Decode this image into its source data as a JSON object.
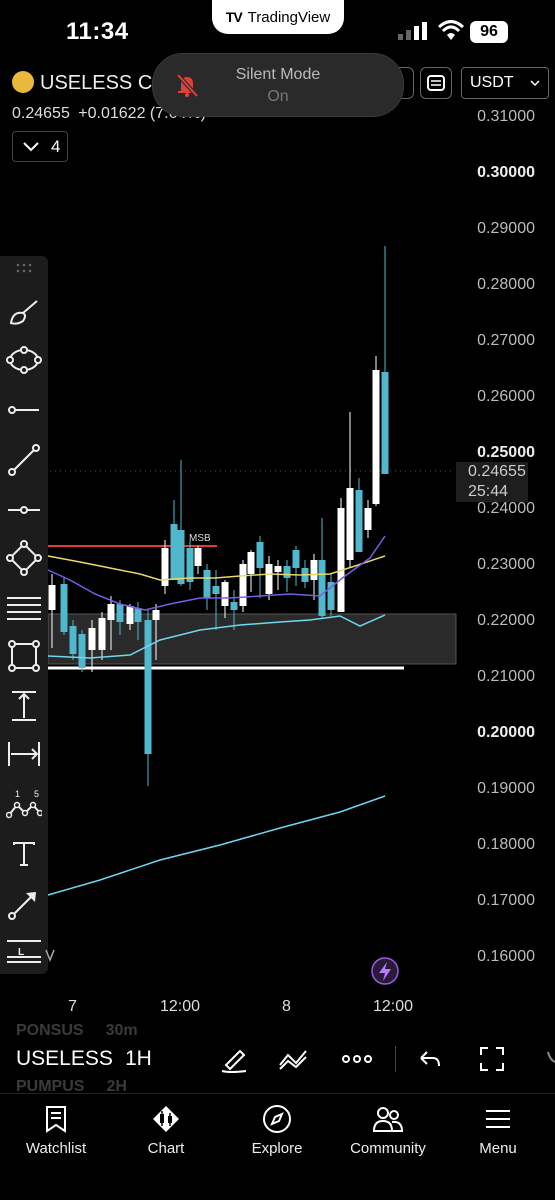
{
  "status_bar": {
    "time": "11:34",
    "battery": "96",
    "app_pill": "TradingView"
  },
  "toast": {
    "title": "Silent Mode",
    "state": "On"
  },
  "header": {
    "symbol": "USELESS C",
    "last_price": "0.24655",
    "change": "+0.01622 (7.64%)",
    "indicator_count": "4",
    "currency": "USDT"
  },
  "price_axis": {
    "labels": [
      "0.31000",
      "0.30000",
      "0.29000",
      "0.28000",
      "0.27000",
      "0.26000",
      "0.25000",
      "0.24000",
      "0.23000",
      "0.22000",
      "0.21000",
      "0.20000",
      "0.19000",
      "0.18000",
      "0.17000",
      "0.16000"
    ],
    "current_price": "0.24655",
    "countdown": "25:44"
  },
  "time_axis": {
    "labels": [
      "7",
      "12:00",
      "8",
      "12:00"
    ]
  },
  "chart": {
    "annotation": "MSB",
    "colors": {
      "up": "#ffffff",
      "down": "#4fb8cc",
      "ma_yellow": "#e8d86a",
      "ma_purple": "#7c5ce0",
      "ma_cyan": "#6fd8ee",
      "msb_line": "#e03a3a"
    }
  },
  "bottom_bar": {
    "symbol": "USELESS",
    "timeframe": "1H",
    "ghost_1": "PONSUS",
    "ghost_1b": "30m",
    "ghost_2": "PUMPUS",
    "ghost_2b": "2H"
  },
  "nav": [
    {
      "label": "Watchlist",
      "icon": "bookmark-icon"
    },
    {
      "label": "Chart",
      "icon": "candles-icon"
    },
    {
      "label": "Explore",
      "icon": "compass-icon"
    },
    {
      "label": "Community",
      "icon": "people-icon"
    },
    {
      "label": "Menu",
      "icon": "hamburger-icon"
    }
  ]
}
